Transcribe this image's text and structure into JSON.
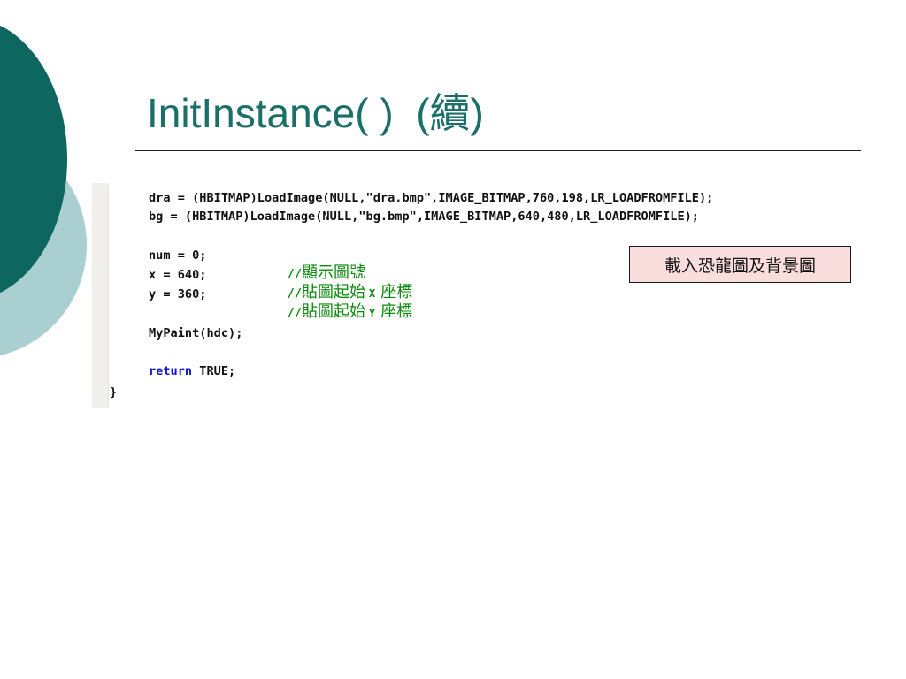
{
  "slide": {
    "title": "InitInstance( )  (續)",
    "note": "載入恐龍圖及背景圖",
    "colors": {
      "title": "#1a6f68",
      "deco_dark": "#0e6661",
      "deco_light": "#a9cfd1",
      "comment": "#0a8a0a",
      "keyword": "#1515d0",
      "note_background": "#fadede"
    }
  },
  "code": {
    "line1": "dra = (HBITMAP)LoadImage(NULL,\"dra.bmp\",IMAGE_BITMAP,760,198,LR_LOADFROMFILE);",
    "line2": "bg = (HBITMAP)LoadImage(NULL,\"bg.bmp\",IMAGE_BITMAP,640,480,LR_LOADFROMFILE);",
    "line3_code": "num = 0;",
    "line3_comment_slashes": "//",
    "line3_comment_text": "顯示圖號",
    "line4_code": "x = 640;",
    "line4_comment_slashes": "//",
    "line4_comment_text": "貼圖起始",
    "line4_comment_axis": "X",
    "line4_comment_tail": "座標",
    "line5_code": "y = 360;",
    "line5_comment_slashes": "//",
    "line5_comment_text": "貼圖起始",
    "line5_comment_axis": "Y",
    "line5_comment_tail": "座標",
    "line6": "MyPaint(hdc);",
    "line7_keyword": "return",
    "line7_rest": " TRUE;",
    "line8": "}"
  }
}
